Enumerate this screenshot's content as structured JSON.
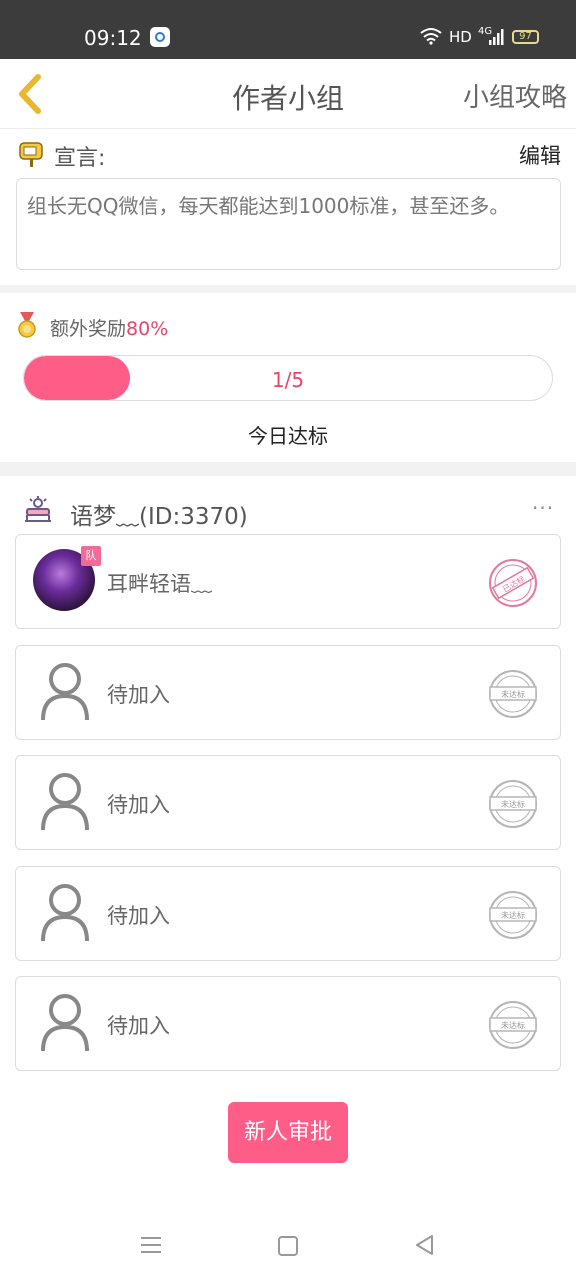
{
  "status_bar": {
    "time": "09:12",
    "network_label": "HD",
    "net_type": "4G",
    "battery": "97"
  },
  "nav": {
    "title": "作者小组",
    "right_link": "小组攻略"
  },
  "declaration": {
    "label": "宣言:",
    "edit_label": "编辑",
    "text": "组长无QQ微信，每天都能达到1000标准，甚至还多。"
  },
  "reward": {
    "label": "额外奖励",
    "percent": "80%",
    "progress_text": "1/5",
    "progress_fraction": 0.2,
    "status_label": "今日达标"
  },
  "team": {
    "name": "语梦﹏(ID:3370)",
    "more": "···",
    "members": [
      {
        "name": "耳畔轻语﹏",
        "badge": "队",
        "stamp": "已达标",
        "status": "achieved"
      },
      {
        "name": "待加入",
        "stamp": "未达标",
        "status": "pending"
      },
      {
        "name": "待加入",
        "stamp": "未达标",
        "status": "pending"
      },
      {
        "name": "待加入",
        "stamp": "未达标",
        "status": "pending"
      },
      {
        "name": "待加入",
        "stamp": "未达标",
        "status": "pending"
      }
    ]
  },
  "approve_button": "新人审批",
  "colors": {
    "accent": "#fe5d88",
    "accent_text": "#e8456a",
    "back_icon": "#e8b830"
  }
}
